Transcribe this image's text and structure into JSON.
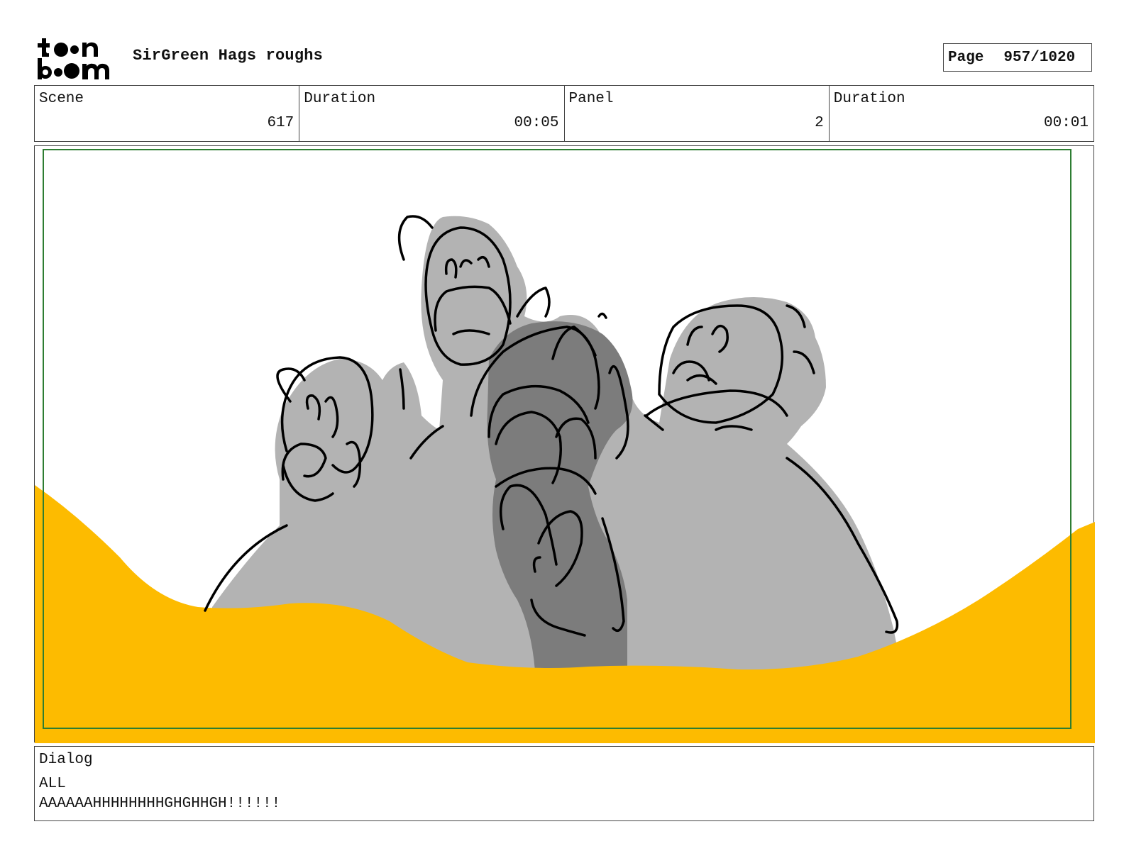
{
  "header": {
    "logo_text": "toonboom",
    "project_title": "SirGreen Hags roughs",
    "page_label": "Page",
    "page_number": "957/1020"
  },
  "info": {
    "scene_label": "Scene",
    "scene_value": "617",
    "scene_duration_label": "Duration",
    "scene_duration_value": "00:05",
    "panel_label": "Panel",
    "panel_value": "2",
    "panel_duration_label": "Duration",
    "panel_duration_value": "00:01"
  },
  "dialog": {
    "label": "Dialog",
    "speaker": "ALL",
    "line": "AAAAAAHHHHHHHHGHGHHGH!!!!!!"
  },
  "colors": {
    "sand": "#FDBB00",
    "figure_light": "#B3B3B3",
    "figure_dark": "#7C7C7C",
    "safe_frame": "#2E7D32",
    "ink": "#000000"
  }
}
